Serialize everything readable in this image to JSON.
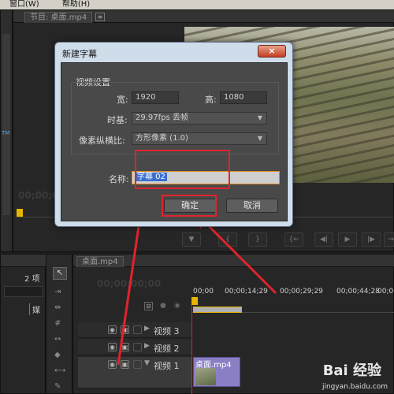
{
  "menubar": {
    "window_menu": "窗口(W)",
    "help_menu": "帮助(H)"
  },
  "program_monitor": {
    "tab_label": "节目: 桌面.mp4",
    "timecode": "00;00;00"
  },
  "project_panel": {
    "item_count": "2 项",
    "media_label": "媒"
  },
  "timeline": {
    "tab_label": "桌面.mp4",
    "timecode": "00;00;00;00",
    "ruler": [
      "00;00",
      "00;00;14;29",
      "00;00;29;29",
      "00;00;44;28",
      "00;00"
    ],
    "tracks": [
      {
        "label": "视频 3"
      },
      {
        "label": "视频 2"
      },
      {
        "label": "视频 1"
      }
    ],
    "clip_label": "桌面.mp4"
  },
  "dialog": {
    "title": "新建字幕",
    "close_icon": "×",
    "video_settings_label": "视频设置",
    "width_label": "宽:",
    "width_value": "1920",
    "height_label": "高:",
    "height_value": "1080",
    "timebase_label": "时基:",
    "timebase_value": "29.97fps 丢帧",
    "pixel_aspect_label": "像素纵横比:",
    "pixel_aspect_value": "方形像素 (1.0)",
    "name_label": "名称:",
    "name_value": "字幕 02",
    "ok_label": "确定",
    "cancel_label": "取消"
  },
  "watermark": {
    "brand": "Bai 经验",
    "url": "jingyan.baidu.com"
  },
  "colors": {
    "annotation_red": "#e0242d",
    "dialog_frame": "#cfdcea",
    "panel_bg": "#262626"
  }
}
